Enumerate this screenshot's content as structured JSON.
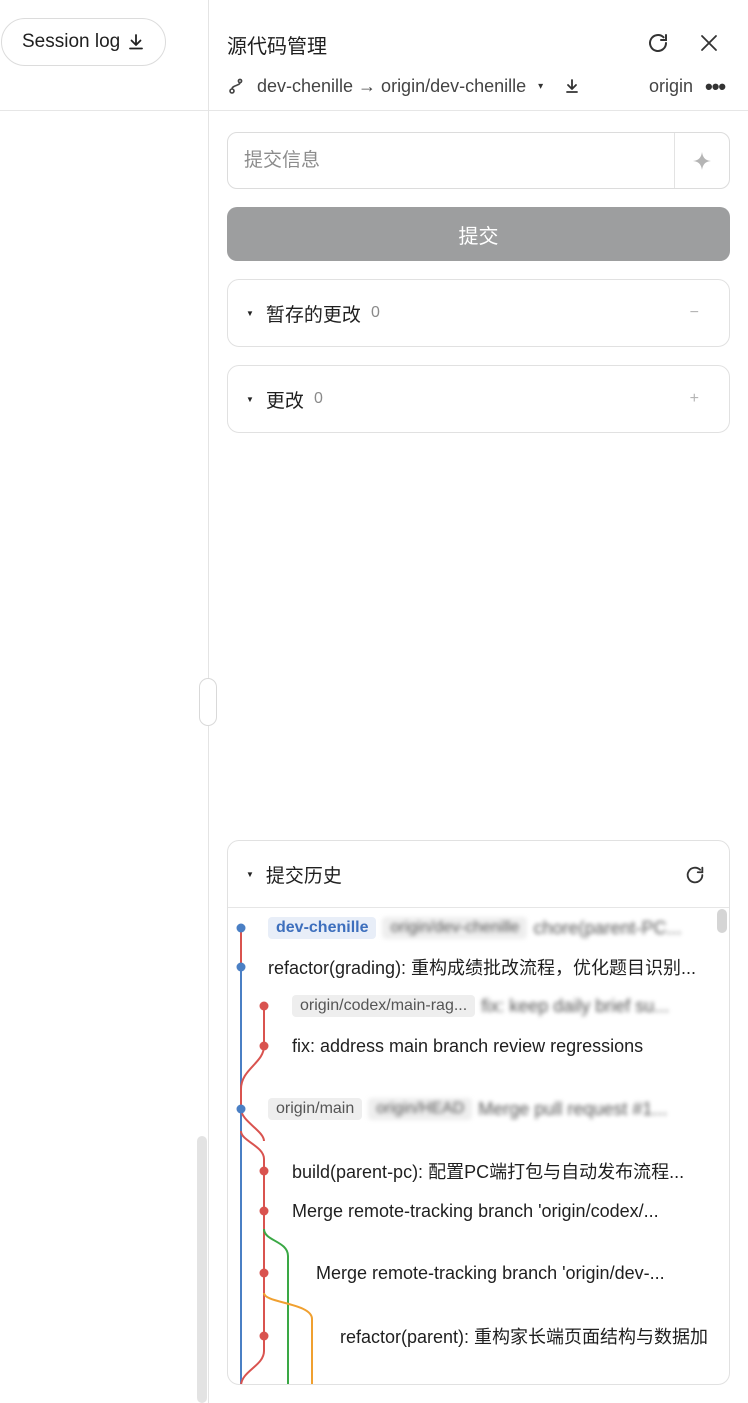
{
  "left": {
    "session_log_label": "Session log"
  },
  "panel": {
    "title": "源代码管理",
    "branch": "dev-chenille → origin/dev-chenille",
    "remote": "origin",
    "more": "•••"
  },
  "commit": {
    "placeholder": "提交信息",
    "submit_label": "提交"
  },
  "staged": {
    "label": "暂存的更改",
    "count": "0",
    "action": "−"
  },
  "changes": {
    "label": "更改",
    "count": "0",
    "action": "+"
  },
  "history": {
    "label": "提交历史",
    "commits": [
      {
        "badges": [
          "dev-chenille",
          "origin/dev-chenille"
        ],
        "message": "chore(parent-PC..."
      },
      {
        "badges": [],
        "message": "refactor(grading): 重构成绩批改流程，优化题目识别..."
      },
      {
        "badges": [
          "origin/codex/main-rag..."
        ],
        "message": "fix: keep daily brief su..."
      },
      {
        "badges": [],
        "message": "fix: address main branch review regressions"
      },
      {
        "badges": [
          "origin/main",
          "origin/HEAD"
        ],
        "message": "Merge pull request #1..."
      },
      {
        "badges": [],
        "message": "build(parent-pc): 配置PC端打包与自动发布流程..."
      },
      {
        "badges": [],
        "message": "Merge remote-tracking branch 'origin/codex/..."
      },
      {
        "badges": [],
        "message": "Merge remote-tracking branch 'origin/dev-..."
      },
      {
        "badges": [],
        "message": "refactor(parent): 重构家长端页面结构与数据加载..."
      }
    ]
  },
  "colors": {
    "graph_blue": "#4a7fc4",
    "graph_red": "#d9534f",
    "graph_green": "#3aa845",
    "graph_orange": "#f0a030",
    "submit_disabled": "#9d9e9f"
  },
  "icons": [
    "download-icon",
    "refresh-icon",
    "close-icon",
    "branch-icon",
    "caret-down-icon",
    "fetch-icon",
    "sparkle-icon",
    "triangle-down-icon"
  ]
}
